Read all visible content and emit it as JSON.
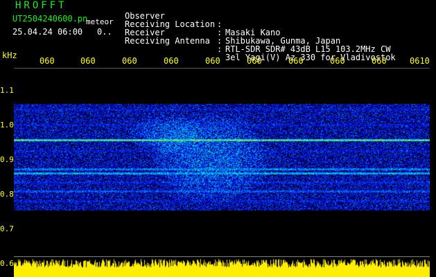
{
  "header": {
    "logo": "HROFFT",
    "filename": "UT2504240600.pn",
    "filetype": "meteor",
    "timestamp": "25.04.24 06:00",
    "value": "0.."
  },
  "meta": [
    {
      "label": "Observer",
      "value": "Masaki Kano"
    },
    {
      "label": "Receiving Location",
      "value": "Shibukawa, Gunma, Japan"
    },
    {
      "label": "Receiver",
      "value": "RTL-SDR SDR# 43dB L15 103.2MHz CW"
    },
    {
      "label": "Receiving Antenna",
      "value": "3el Yagi(V) Az 330 for Vladivostok"
    }
  ],
  "axis": {
    "unit": "kHz",
    "y_ticks": [
      "1.1",
      "1.0",
      "0.9",
      "0.8",
      "0.7",
      "0.6"
    ],
    "x_ticks": [
      "060",
      "060",
      "060",
      "060",
      "060",
      "060",
      "060",
      "060",
      "060",
      "0610"
    ]
  },
  "colors": {
    "label_green": "#22ee22",
    "axis_yellow": "#ffff33",
    "signal_red": "#ff3344",
    "background": "#000000"
  }
}
